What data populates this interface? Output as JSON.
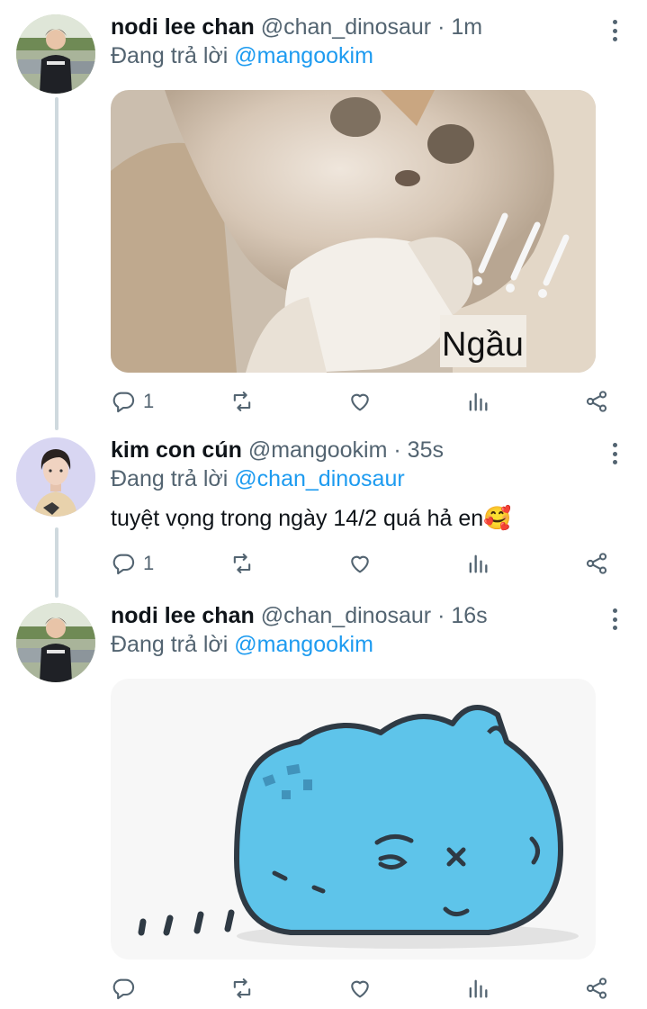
{
  "tweets": [
    {
      "name": "nodi lee chan",
      "handle": "@chan_dinosaur",
      "separator": "·",
      "time": "1m",
      "reply_prefix": "Đang trả lời",
      "reply_to": "@mangookim",
      "image_caption": "Ngầu",
      "reply_count": "1"
    },
    {
      "name": "kim con cún",
      "handle": "@mangookim",
      "separator": "·",
      "time": "35s",
      "reply_prefix": "Đang trả lời",
      "reply_to": "@chan_dinosaur",
      "text": "tuyệt vọng trong ngày 14/2 quá hả en",
      "emoji": "🥰",
      "reply_count": "1"
    },
    {
      "name": "nodi lee chan",
      "handle": "@chan_dinosaur",
      "separator": "·",
      "time": "16s",
      "reply_prefix": "Đang trả lời",
      "reply_to": "@mangookim",
      "reply_count": ""
    }
  ],
  "icons": {
    "reply": "reply-icon",
    "retweet": "retweet-icon",
    "like": "like-icon",
    "views": "views-icon",
    "share": "share-icon",
    "more": "more-icon"
  },
  "colors": {
    "accent": "#1d9bf0",
    "secondary_text": "#536471",
    "thread_line": "#cfd9de",
    "sticker_blue": "#5ec4ea"
  }
}
